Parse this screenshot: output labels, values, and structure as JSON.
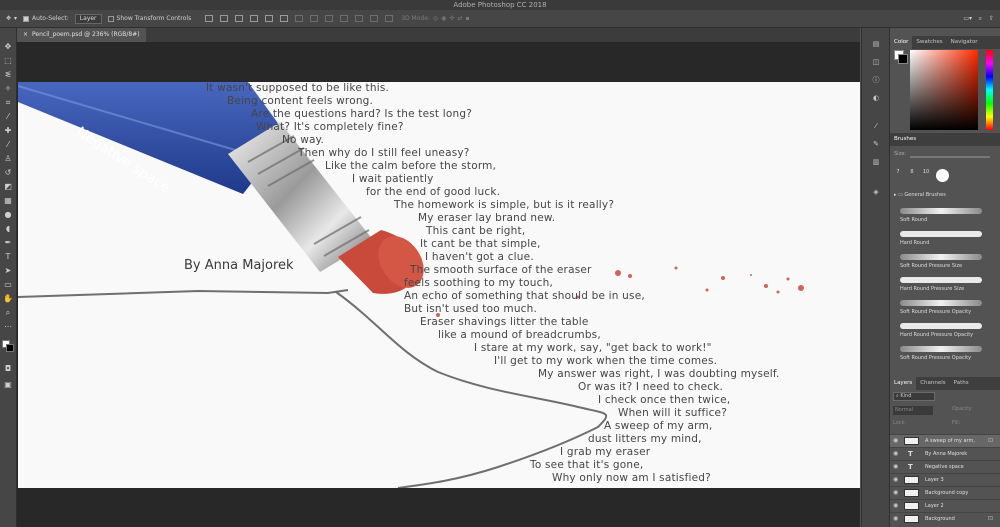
{
  "window": {
    "title": "Adobe Photoshop CC 2018"
  },
  "options_bar": {
    "auto_select_label": "Auto-Select:",
    "auto_select_target": "Layer",
    "show_transform_label": "Show Transform Controls",
    "mode_3d_label": "3D Mode:"
  },
  "document": {
    "tab_title": "Pencil_poem.psd @ 236% (RGB/8#)",
    "close_glyph": "×"
  },
  "canvas": {
    "eraser_label": "Negative space",
    "byline": "By Anna Majorek",
    "poem_lines": [
      "It wasn't supposed to be like this.",
      "Being content feels wrong.",
      "Are the questions hard? Is the test long?",
      "What? It's completely fine?",
      "No way.",
      "Then why do I still feel uneasy?",
      "Like the calm before the storm,",
      "I wait patiently",
      "for the end of good luck.",
      "The homework is simple, but is it really?",
      "My eraser lay brand new.",
      "This cant be right,",
      "It cant be that simple,",
      "I haven't got a clue.",
      "The smooth surface of the eraser",
      "feels soothing to my touch,",
      "An echo of something that should be in use,",
      "But isn't used too much.",
      "Eraser shavings litter the table",
      "like a mound of breadcrumbs,",
      "I stare at my work, say, \"get back to work!\"",
      "I'll get to my work when the time comes.",
      "My answer was right, I was doubting myself.",
      "Or was it? I need to check.",
      "I check once then twice,",
      "When will it suffice?",
      "A sweep of my arm,",
      "dust litters my mind,",
      "I grab my eraser",
      "To see that it's gone,",
      "Why only now am I satisfied?"
    ]
  },
  "color_panel": {
    "tabs": [
      "Color",
      "Swatches",
      "Navigator"
    ],
    "active_tab": "Color"
  },
  "brushes_panel": {
    "title": "Brushes",
    "size_label": "Size:",
    "preset_sizes": [
      "7",
      "8",
      "10"
    ],
    "group_name": "General Brushes",
    "items": [
      "Soft Round",
      "Hard Round",
      "Soft Round Pressure Size",
      "Hard Round Pressure Size",
      "Soft Round Pressure Opacity",
      "Hard Round Pressure Opacity",
      "Soft Round Pressure Opacity"
    ]
  },
  "layers_panel": {
    "tabs": [
      "Layers",
      "Channels",
      "Paths"
    ],
    "active_tab": "Layers",
    "kind_filter": "Kind",
    "blend_mode": "Normal",
    "opacity_label": "Opacity:",
    "lock_label": "Lock:",
    "fill_label": "Fill:",
    "layers": [
      {
        "name": "A sweep of my arm,",
        "type": "text-block",
        "selected": true,
        "locked": true
      },
      {
        "name": "By Anna Majorek",
        "type": "text",
        "selected": false,
        "locked": false
      },
      {
        "name": "Negative space",
        "type": "text",
        "selected": false,
        "locked": false
      },
      {
        "name": "Layer 3",
        "type": "pixel",
        "selected": false,
        "locked": false
      },
      {
        "name": "Background copy",
        "type": "pixel",
        "selected": false,
        "locked": false
      },
      {
        "name": "Layer 2",
        "type": "pixel",
        "selected": false,
        "locked": false
      },
      {
        "name": "Background",
        "type": "pixel",
        "selected": false,
        "locked": true
      }
    ]
  },
  "tool_icons": [
    "move-icon",
    "marquee-icon",
    "lasso-icon",
    "magic-wand-icon",
    "crop-icon",
    "eyedropper-icon",
    "healing-brush-icon",
    "brush-icon",
    "clone-stamp-icon",
    "history-brush-icon",
    "eraser-icon",
    "gradient-icon",
    "blur-icon",
    "dodge-icon",
    "pen-icon",
    "type-icon",
    "path-selection-icon",
    "rectangle-icon",
    "hand-icon",
    "zoom-icon"
  ],
  "colors": {
    "pencil_blue": "#2c4aa0",
    "eraser_red": "#c9493b",
    "ui_dark": "#535353"
  }
}
